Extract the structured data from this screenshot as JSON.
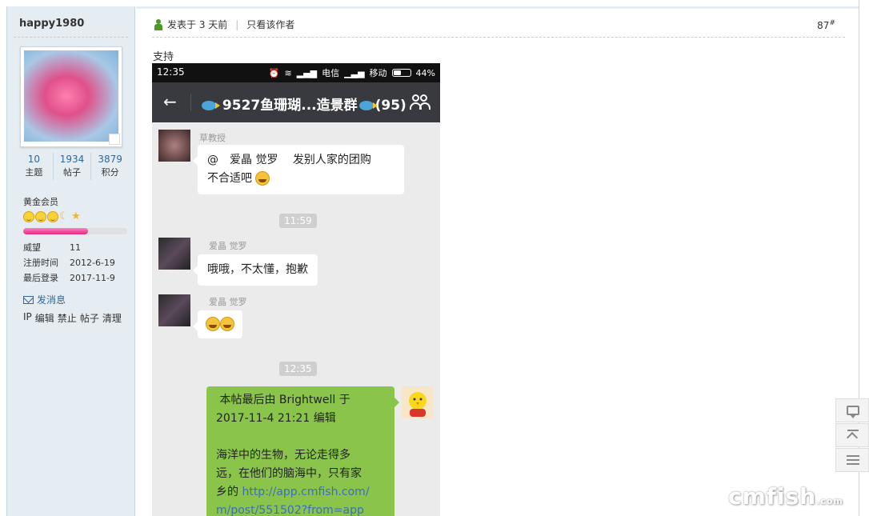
{
  "user": {
    "name": "happy1980",
    "stats": [
      {
        "num": "10",
        "label": "主题"
      },
      {
        "num": "1934",
        "label": "帖子"
      },
      {
        "num": "3879",
        "label": "积分"
      }
    ],
    "group": "黄金会员",
    "level_progress": 0.62,
    "info": [
      {
        "key": "威望",
        "value": "11"
      },
      {
        "key": "注册时间",
        "value": "2012-6-19"
      },
      {
        "key": "最后登录",
        "value": "2017-11-9"
      }
    ],
    "send_message": "发消息",
    "admin_links": [
      "IP",
      "编辑",
      "禁止",
      "帖子",
      "清理"
    ]
  },
  "post": {
    "posted": "发表于 3 天前",
    "only_author": "只看该作者",
    "floor_num": "87",
    "floor_mark": "#",
    "text": "支持"
  },
  "phone": {
    "time": "12:35",
    "carrier1": "电信",
    "carrier2": "移动",
    "battery": "44%",
    "back": "←",
    "title_name": "9527鱼珊瑚...造景群",
    "title_count": "(95)",
    "messages": [
      {
        "sender": "草教授",
        "text1": "@　爱晶 觉罗　 发别人家的团购",
        "text2": "不合适吧"
      },
      {
        "timestamp": "11:59"
      },
      {
        "sender": "爱晶 觉罗",
        "text": "哦哦，不太懂，抱歉"
      },
      {
        "sender": "爱晶 觉罗"
      },
      {
        "timestamp": "12:35"
      },
      {
        "edit1": "本帖最后由 Brightwell 于",
        "edit2": "2017-11-4 21:21 编辑",
        "body1": "海洋中的生物，无论走得多",
        "body2": "远，在他们的脑海中，只有家",
        "body3": "乡的",
        "link1": "http://app.cmfish.com/",
        "link2": "m/post/551502?from=app"
      }
    ]
  },
  "watermark": {
    "main": "cmfish",
    "sub": ".com"
  }
}
